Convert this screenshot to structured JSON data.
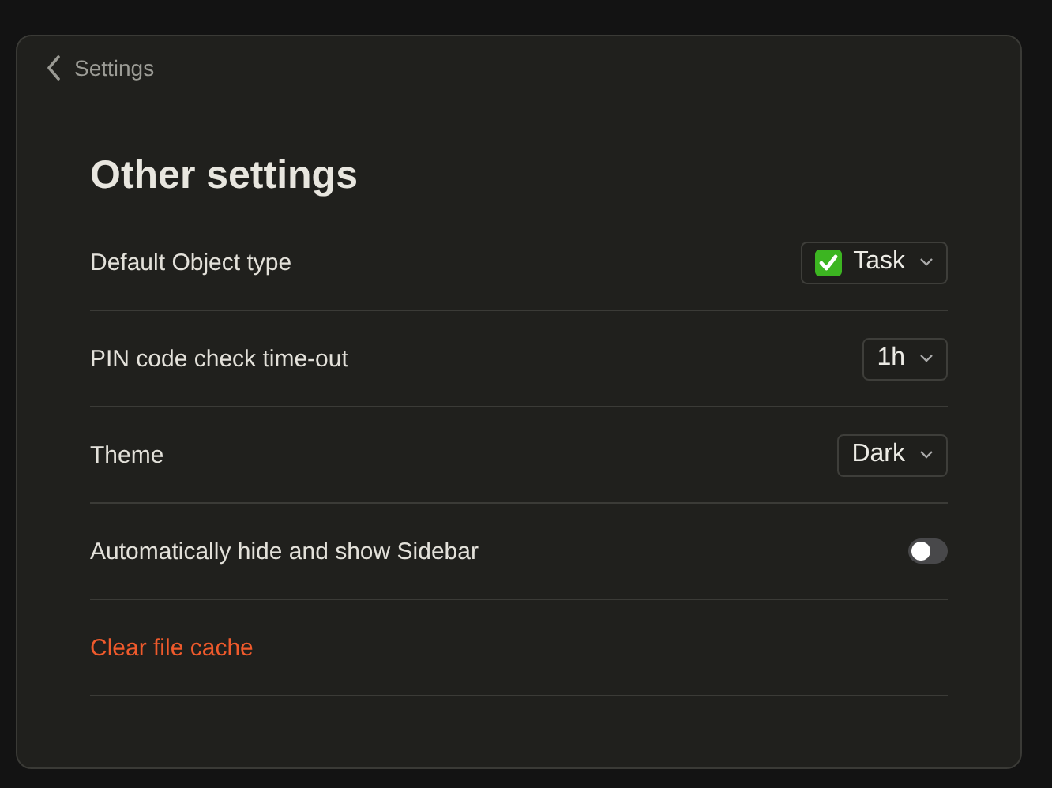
{
  "back_link": {
    "label": "Settings"
  },
  "title": "Other settings",
  "rows": [
    {
      "kind": "object-select",
      "label": "Default Object type",
      "value": "Task"
    },
    {
      "kind": "select",
      "label": "PIN code check time-out",
      "value": "1h"
    },
    {
      "kind": "select",
      "label": "Theme",
      "value": "Dark"
    },
    {
      "kind": "toggle",
      "label": "Automatically hide and show Sidebar",
      "on": false
    },
    {
      "kind": "action",
      "label": "Clear file cache"
    }
  ]
}
